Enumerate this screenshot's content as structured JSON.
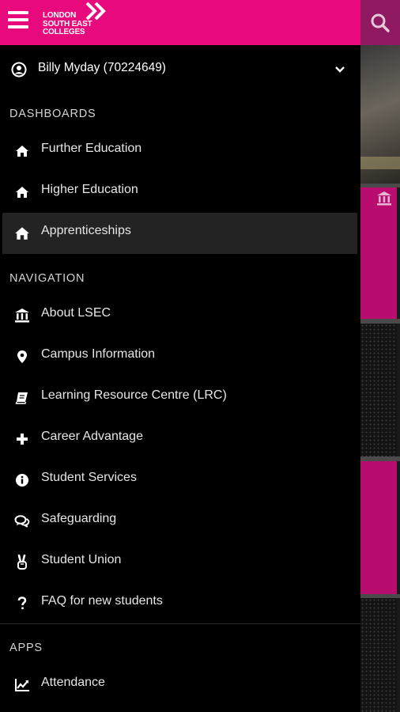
{
  "header": {
    "logo_lines": [
      "LONDON",
      "SOUTH EAST",
      "COLLEGES"
    ],
    "menu_icon": "hamburger-icon",
    "search_icon": "search-icon",
    "colors": {
      "brand_pink": "#e8097d",
      "background": "#000000"
    }
  },
  "user": {
    "name": "Billy Myday (70224649)",
    "icon": "user-circle-icon",
    "expand_icon": "chevron-down-icon"
  },
  "sections": {
    "dashboards": {
      "title": "DASHBOARDS",
      "items": [
        {
          "label": "Further Education",
          "icon": "home-icon"
        },
        {
          "label": "Higher Education",
          "icon": "home-icon"
        },
        {
          "label": "Apprenticeships",
          "icon": "home-icon",
          "active": true
        }
      ]
    },
    "navigation": {
      "title": "NAVIGATION",
      "items": [
        {
          "label": "About LSEC",
          "icon": "institution-icon"
        },
        {
          "label": "Campus Information",
          "icon": "map-pin-icon"
        },
        {
          "label": "Learning Resource Centre (LRC)",
          "icon": "book-icon"
        },
        {
          "label": "Career Advantage",
          "icon": "plus-icon"
        },
        {
          "label": "Student Services",
          "icon": "info-icon"
        },
        {
          "label": "Safeguarding",
          "icon": "chat-icon"
        },
        {
          "label": "Student Union",
          "icon": "peace-hand-icon"
        },
        {
          "label": "FAQ for new students",
          "icon": "question-icon"
        }
      ]
    },
    "apps": {
      "title": "APPS",
      "items": [
        {
          "label": "Attendance",
          "icon": "line-chart-icon"
        }
      ]
    }
  }
}
